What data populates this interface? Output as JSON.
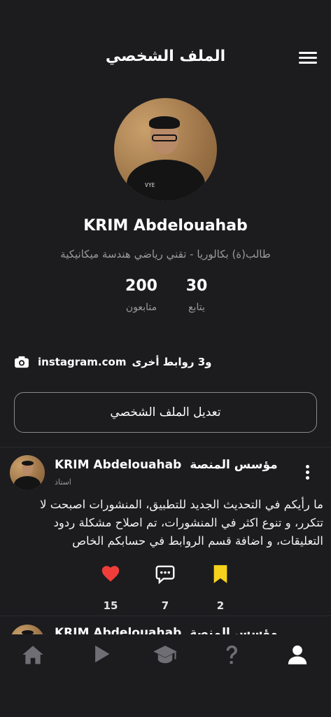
{
  "header": {
    "title": "الملف الشخصي",
    "menu_icon": "hamburger-menu-icon"
  },
  "profile": {
    "name": "KRIM Abdelouahab",
    "bio": "طالب(ة) بكالوريا - تقني رياضي هندسة ميكانيكية",
    "avatar_shirt_text": "VYE",
    "stats": {
      "followers_count": "200",
      "followers_label": "متابعون",
      "following_count": "30",
      "following_label": "يتابع"
    },
    "links": {
      "icon": "camera-icon",
      "primary": "instagram.com",
      "more": "و3 روابط أخرى"
    },
    "edit_button": "تعديل الملف الشخصي"
  },
  "posts": [
    {
      "author": "KRIM Abdelouahab",
      "badge": "مؤسس المنصة",
      "role": "استاذ",
      "text": "ما رأيكم في التحديث الجديد للتطبيق، المنشورات اصبحت لا تتكرر، و تنوع اكثر في المنشورات، تم اصلاح مشكلة ردود التعليقات، و اضافة قسم الروابط في حسابكم الخاص",
      "likes": "15",
      "comments": "7",
      "saves": "2",
      "colors": {
        "like": "#ef3e3a",
        "save": "#f6d21c",
        "comment": "#ffffff"
      }
    },
    {
      "author": "KRIM Abdelouahab",
      "badge": "مؤسس المنصة"
    }
  ],
  "bottom_nav": [
    {
      "icon": "home-icon",
      "active": false
    },
    {
      "icon": "play-icon",
      "active": false
    },
    {
      "icon": "graduation-cap-icon",
      "active": false
    },
    {
      "icon": "question-mark-icon",
      "active": false
    },
    {
      "icon": "profile-icon",
      "active": true
    }
  ],
  "theme": {
    "background": "#1c1c1f",
    "text": "#ffffff",
    "muted": "#9a9a9a",
    "nav_inactive": "#6e6e74"
  }
}
